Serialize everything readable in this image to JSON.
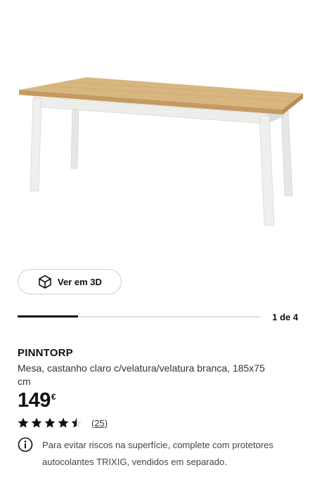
{
  "gallery": {
    "view3d_label": "Ver em 3D",
    "pager_text": "1 de 4",
    "progress_fraction": 0.25
  },
  "product": {
    "name": "PINNTORP",
    "description": "Mesa, castanho claro c/velatura/velatura branca, 185x75 cm",
    "price": "149",
    "currency": "€",
    "rating_stars": 4.5,
    "rating_count": "(25)"
  },
  "notice": {
    "text": "Para evitar riscos na superfície, complete com protetores autocolantes TRIXIG, vendidos em separado."
  },
  "icons": {
    "view3d": "cube-icon",
    "info": "info-icon",
    "star": "star-icon"
  },
  "colors": {
    "text": "#111111",
    "wood": "#d6b27e",
    "legs": "#ececea"
  }
}
